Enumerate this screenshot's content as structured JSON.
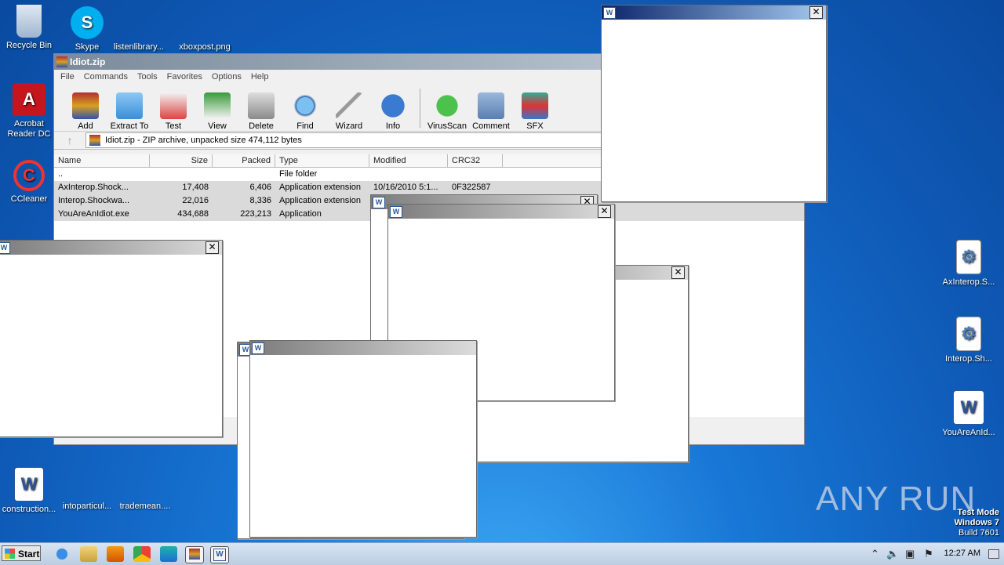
{
  "desktop": {
    "icons": [
      {
        "label": "Recycle Bin"
      },
      {
        "label": "Skype"
      },
      {
        "label": "listenlibrary..."
      },
      {
        "label": "xboxpost.png"
      },
      {
        "label": "Acrobat Reader DC"
      },
      {
        "label": "CCleaner"
      },
      {
        "label": "construction..."
      },
      {
        "label": "intoparticul..."
      },
      {
        "label": "trademean...."
      },
      {
        "label": "AxInterop.S..."
      },
      {
        "label": "Interop.Sh..."
      },
      {
        "label": "YouAreAnId..."
      }
    ]
  },
  "winrar": {
    "title": "Idiot.zip",
    "menu": [
      "File",
      "Commands",
      "Tools",
      "Favorites",
      "Options",
      "Help"
    ],
    "toolbar": [
      "Add",
      "Extract To",
      "Test",
      "View",
      "Delete",
      "Find",
      "Wizard",
      "Info",
      "VirusScan",
      "Comment",
      "SFX"
    ],
    "address": "Idiot.zip - ZIP archive, unpacked size 474,112 bytes",
    "columns": [
      "Name",
      "Size",
      "Packed",
      "Type",
      "Modified",
      "CRC32"
    ],
    "files": [
      {
        "name": "..",
        "size": "",
        "packed": "",
        "type": "File folder",
        "modified": "",
        "crc": ""
      },
      {
        "name": "AxInterop.Shock...",
        "size": "17,408",
        "packed": "6,406",
        "type": "Application extension",
        "modified": "10/16/2010 5:1...",
        "crc": "0F322587"
      },
      {
        "name": "Interop.Shockwa...",
        "size": "22,016",
        "packed": "8,336",
        "type": "Application extension",
        "modified": "",
        "crc": ""
      },
      {
        "name": "YouAreAnIdiot.exe",
        "size": "434,688",
        "packed": "223,213",
        "type": "Application",
        "modified": "",
        "crc": ""
      }
    ]
  },
  "popup_close": "✕",
  "taskbar": {
    "start_label": "Start",
    "clock": "12:27 AM"
  },
  "watermark": "ANY RUN",
  "testmode": {
    "line1": "Test Mode",
    "line2": "Windows 7",
    "line3": "Build 7601"
  }
}
